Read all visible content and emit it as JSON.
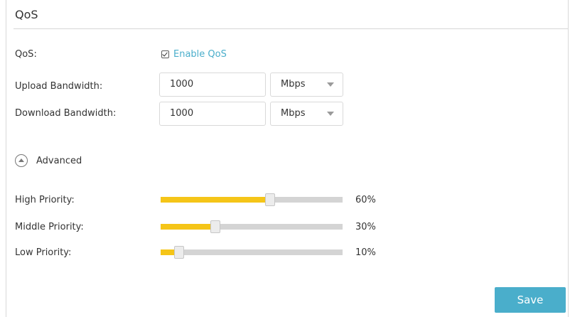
{
  "section": {
    "title": "QoS"
  },
  "qos": {
    "label": "QoS:",
    "checkbox_label": "Enable QoS",
    "checked": true
  },
  "upload": {
    "label": "Upload Bandwidth:",
    "value": "1000",
    "unit": "Mbps"
  },
  "download": {
    "label": "Download Bandwidth:",
    "value": "1000",
    "unit": "Mbps"
  },
  "advanced": {
    "label": "Advanced",
    "icon": "chevron-up-circle-icon"
  },
  "priorities": [
    {
      "label": "High Priority:",
      "percent_text": "60%",
      "value": 60
    },
    {
      "label": "Middle Priority:",
      "percent_text": "30%",
      "value": 30
    },
    {
      "label": "Low Priority:",
      "percent_text": "10%",
      "value": 10
    }
  ],
  "save_label": "Save",
  "colors": {
    "accent": "#4aaecb",
    "slider_fill": "#f5c518",
    "slider_track": "#d4d4d4"
  }
}
